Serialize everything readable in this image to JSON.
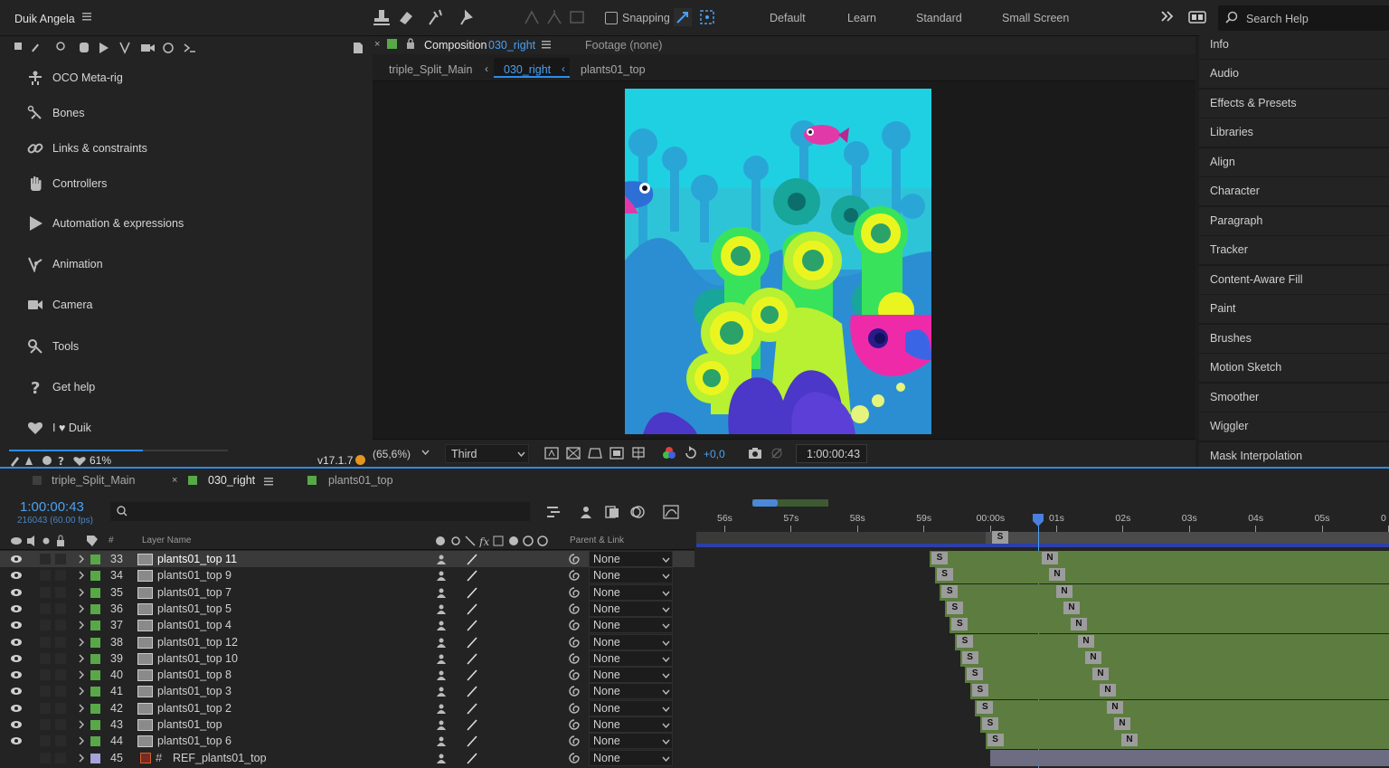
{
  "duik": {
    "title": "Duik Angela",
    "items": [
      {
        "label": "OCO Meta-rig",
        "icon": "meta-rig-icon"
      },
      {
        "label": "Bones",
        "icon": "bones-icon"
      },
      {
        "label": "Links & constraints",
        "icon": "link-icon"
      },
      {
        "label": "Controllers",
        "icon": "hand-icon"
      },
      {
        "label": "Automation & expressions",
        "icon": "play-icon"
      },
      {
        "label": "Animation",
        "icon": "animation-icon"
      },
      {
        "label": "Camera",
        "icon": "camera-icon"
      },
      {
        "label": "Tools",
        "icon": "tools-icon"
      },
      {
        "label": "Get help",
        "icon": "help-icon"
      },
      {
        "label": "I ♥ Duik",
        "icon": "heart-icon"
      }
    ],
    "status_percent": "61%",
    "progress": 0.61,
    "version": "v17.1.7"
  },
  "toolbar": {
    "snapping": "Snapping",
    "workspaces": [
      "Default",
      "Learn",
      "Standard",
      "Small Screen"
    ],
    "search_placeholder": "Search Help"
  },
  "comp": {
    "tab_prefix": "Composition",
    "tab_name": "030_right",
    "footage": "Footage (none)",
    "breadcrumbs": [
      "triple_Split_Main",
      "030_right",
      "plants01_top"
    ],
    "zoom": "(65,6%)",
    "resolution": "Third",
    "exposure": "+0,0",
    "timecode": "1:00:00:43"
  },
  "right_panels": [
    "Info",
    "Audio",
    "Effects & Presets",
    "Libraries",
    "Align",
    "Character",
    "Paragraph",
    "Tracker",
    "Content-Aware Fill",
    "Paint",
    "Brushes",
    "Motion Sketch",
    "Smoother",
    "Wiggler",
    "Mask Interpolation"
  ],
  "timeline": {
    "tabs": [
      "triple_Split_Main",
      "030_right",
      "plants01_top"
    ],
    "timecode": "1:00:00:43",
    "frame_info": "216043 (60.00 fps)",
    "col_layer_name": "Layer Name",
    "col_parent": "Parent & Link",
    "col_hash": "#",
    "ruler": [
      "56s",
      "57s",
      "58s",
      "59s",
      "00:00s",
      "01s",
      "02s",
      "03s",
      "04s",
      "05s",
      "0"
    ],
    "layers": [
      {
        "num": "33",
        "name": "plants01_top 11",
        "parent": "None",
        "s": "S",
        "n": "N"
      },
      {
        "num": "34",
        "name": "plants01_top 9",
        "parent": "None",
        "s": "S",
        "n": "N"
      },
      {
        "num": "35",
        "name": "plants01_top 7",
        "parent": "None",
        "s": "S",
        "n": "N"
      },
      {
        "num": "36",
        "name": "plants01_top 5",
        "parent": "None",
        "s": "S",
        "n": "N"
      },
      {
        "num": "37",
        "name": "plants01_top 4",
        "parent": "None",
        "s": "S",
        "n": "N"
      },
      {
        "num": "38",
        "name": "plants01_top 12",
        "parent": "None",
        "s": "S",
        "n": "N"
      },
      {
        "num": "39",
        "name": "plants01_top 10",
        "parent": "None",
        "s": "S",
        "n": "N"
      },
      {
        "num": "40",
        "name": "plants01_top 8",
        "parent": "None",
        "s": "S",
        "n": "N"
      },
      {
        "num": "41",
        "name": "plants01_top 3",
        "parent": "None",
        "s": "S",
        "n": "N"
      },
      {
        "num": "42",
        "name": "plants01_top 2",
        "parent": "None",
        "s": "S",
        "n": "N"
      },
      {
        "num": "43",
        "name": "plants01_top",
        "parent": "None",
        "s": "S",
        "n": "N"
      },
      {
        "num": "44",
        "name": "plants01_top 6",
        "parent": "None",
        "s": "S",
        "n": "N"
      },
      {
        "num": "45",
        "name": "REF_plants01_top",
        "parent": "None",
        "s": "",
        "n": ""
      }
    ],
    "work_area_marker": "S"
  },
  "colors": {
    "accent_blue": "#2d8ceb",
    "label_green": "#58a848",
    "track_green": "#5c7d3f",
    "label_lavender": "#a7a2d9"
  }
}
